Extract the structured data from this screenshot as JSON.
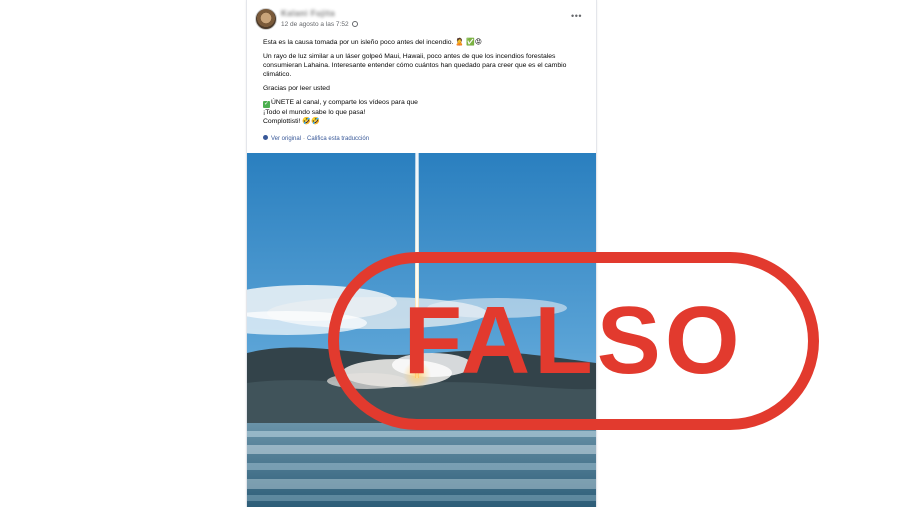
{
  "post": {
    "author": "Kalani Fujita",
    "timestamp": "12 de agosto a las 7:52",
    "paragraphs": [
      "Esta es la causa tomada por un isleño poco antes del incendio.",
      "Un rayo de luz similar a un láser golpeó Maui, Hawaii, poco antes de que los incendios forestales consumieran Lahaina. Interesante entender cómo cuántos han quedado para creer que es el cambio climático.",
      "Gracias por leer usted"
    ],
    "cta_lines": [
      "ÚNETE al canal, y comparte los vídeos para que",
      "¡Todo el mundo sabe lo que pasa!",
      "Complottisti!"
    ],
    "emojis": {
      "p1": "🙎 ✅😡",
      "check": "✓",
      "laugh": "🤣🤣"
    },
    "translate": {
      "original_label": "Ver original",
      "separator": "·",
      "rate_label": "Califica esta traducción"
    },
    "more_icon": "more-horizontal-icon"
  },
  "stamp": {
    "label": "FALSO",
    "color": "#e23a2e"
  }
}
